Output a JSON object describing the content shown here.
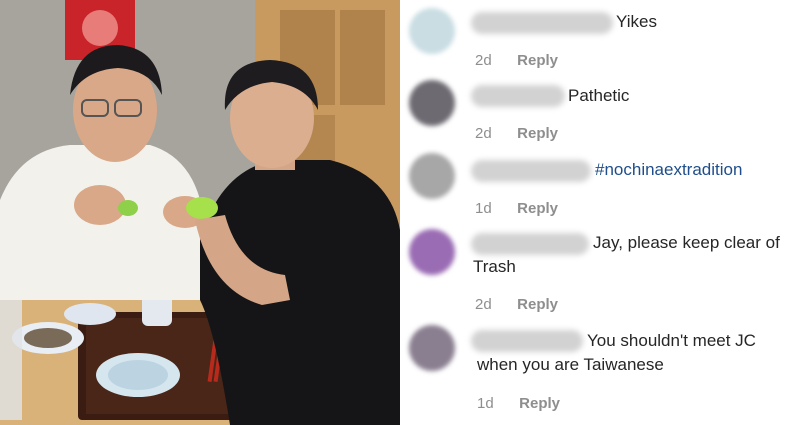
{
  "comments": [
    {
      "text": "Yikes",
      "time": "2d",
      "reply": "Reply",
      "avatar_color": "#c9dde3"
    },
    {
      "text": "Pathetic",
      "time": "2d",
      "reply": "Reply",
      "avatar_color": "#6e6a72"
    },
    {
      "text": "#nochinaextradition",
      "time": "1d",
      "reply": "Reply",
      "avatar_color": "#a7a7a7"
    },
    {
      "text_line1": "Jay, please keep clear of",
      "text_line2": "Trash",
      "time": "2d",
      "reply": "Reply",
      "avatar_color": "#9a6cb4"
    },
    {
      "text_line1": "You shouldn't meet JC",
      "text_line2": "when you are Taiwanese",
      "time": "1d",
      "reply": "Reply",
      "avatar_color": "#8a7f90"
    }
  ],
  "colors": {
    "text": "#262626",
    "hashtag": "#1f4e8a",
    "meta": "#8e8e8e"
  }
}
